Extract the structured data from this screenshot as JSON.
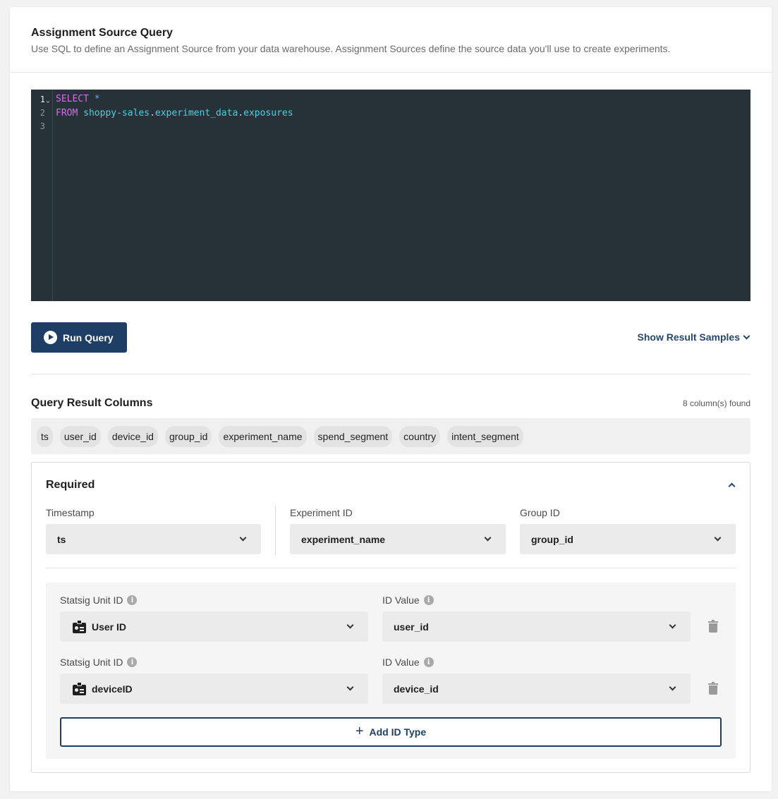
{
  "header": {
    "title": "Assignment Source Query",
    "subtitle": "Use SQL to define an Assignment Source from your data warehouse. Assignment Sources define the source data you'll use to create experiments."
  },
  "editor": {
    "line_numbers": [
      "1",
      "2",
      "3"
    ],
    "fold_marker": "⌄",
    "lines": [
      {
        "keyword": "SELECT",
        "rest": "*"
      },
      {
        "keyword": "FROM",
        "table_parts": [
          "shoppy-sales",
          "experiment_data",
          "exposures"
        ]
      },
      {
        "keyword": "",
        "rest": ""
      }
    ]
  },
  "toolbar": {
    "run_label": "Run Query",
    "samples_label": "Show Result Samples"
  },
  "query_results": {
    "title": "Query Result Columns",
    "count_text": "8 column(s) found",
    "columns": [
      "ts",
      "user_id",
      "device_id",
      "group_id",
      "experiment_name",
      "spend_segment",
      "country",
      "intent_segment"
    ]
  },
  "required": {
    "title": "Required",
    "timestamp": {
      "label": "Timestamp",
      "value": "ts"
    },
    "experiment_id": {
      "label": "Experiment ID",
      "value": "experiment_name"
    },
    "group_id": {
      "label": "Group ID",
      "value": "group_id"
    },
    "units": [
      {
        "unit_label": "Statsig Unit ID",
        "unit_value": "User ID",
        "id_label": "ID Value",
        "id_value": "user_id"
      },
      {
        "unit_label": "Statsig Unit ID",
        "unit_value": "deviceID",
        "id_label": "ID Value",
        "id_value": "device_id"
      }
    ],
    "add_label": "Add ID Type"
  },
  "icons": {
    "play": "play-circle-icon",
    "chevron": "chevron-down-icon",
    "info": "info-icon",
    "id_badge": "id-badge-icon",
    "trash": "trash-icon",
    "plus": "plus-icon"
  },
  "colors": {
    "primary": "#1e3e66",
    "editor_bg": "#263238",
    "keyword": "#d96ce8",
    "identifier": "#4dd0e1"
  }
}
